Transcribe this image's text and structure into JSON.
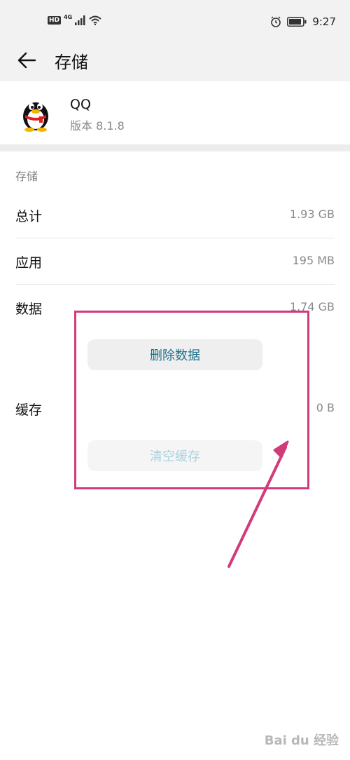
{
  "status_bar": {
    "hd": "HD",
    "network": "4G",
    "time": "9:27",
    "icons": [
      "signal-icon",
      "wifi-icon",
      "alarm-icon",
      "battery-icon"
    ]
  },
  "header": {
    "back_icon": "back-arrow-icon",
    "title": "存储"
  },
  "app": {
    "name": "QQ",
    "version": "版本 8.1.8",
    "icon": "qq-penguin-icon"
  },
  "storage": {
    "section_title": "存储",
    "rows": [
      {
        "label": "总计",
        "value": "1.93 GB"
      },
      {
        "label": "应用",
        "value": "195 MB"
      },
      {
        "label": "数据",
        "value": "1.74 GB"
      },
      {
        "label": "缓存",
        "value": "0 B"
      }
    ]
  },
  "buttons": {
    "delete_data": "删除数据",
    "clear_cache": "清空缓存"
  },
  "annotation": {
    "color": "#d23b7a"
  },
  "watermark": "Bai du 经验"
}
